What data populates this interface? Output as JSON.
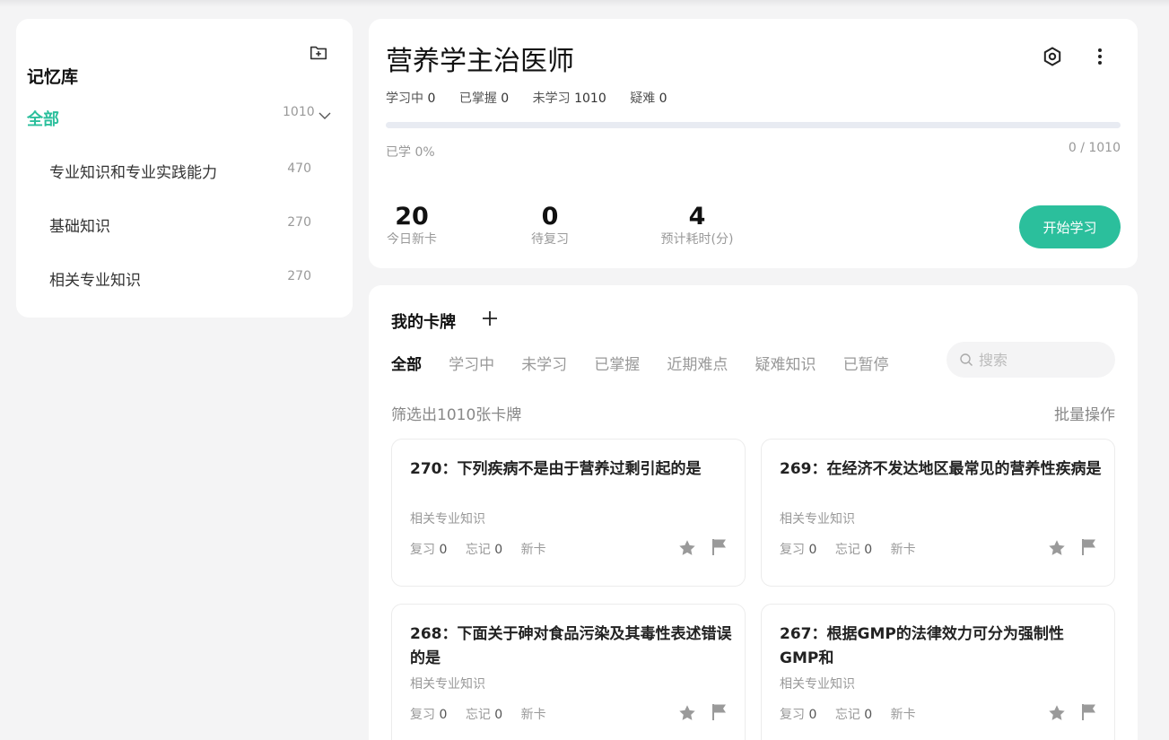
{
  "sidebar": {
    "title": "记忆库",
    "add_icon": "folder-plus-icon",
    "all": {
      "label": "全部",
      "count": "1010"
    },
    "items": [
      {
        "label": "专业知识和专业实践能力",
        "count": "470"
      },
      {
        "label": "基础知识",
        "count": "270"
      },
      {
        "label": "相关专业知识",
        "count": "270"
      }
    ]
  },
  "deck": {
    "title": "营养学主治医师",
    "stats": [
      {
        "label": "学习中",
        "value": "0"
      },
      {
        "label": "已掌握",
        "value": "0"
      },
      {
        "label": "未学习",
        "value": "1010"
      },
      {
        "label": "疑难",
        "value": "0"
      }
    ],
    "progress": {
      "percent": 0,
      "left_text": "已学 0%",
      "right_text": "0 / 1010"
    },
    "big_stats": [
      {
        "value": "20",
        "label": "今日新卡"
      },
      {
        "value": "0",
        "label": "待复习"
      },
      {
        "value": "4",
        "label": "预计耗时(分)"
      }
    ],
    "start_label": "开始学习"
  },
  "cards_panel": {
    "title": "我的卡牌",
    "tabs": [
      {
        "label": "全部",
        "active": true
      },
      {
        "label": "学习中",
        "active": false
      },
      {
        "label": "未学习",
        "active": false
      },
      {
        "label": "已掌握",
        "active": false
      },
      {
        "label": "近期难点",
        "active": false
      },
      {
        "label": "疑难知识",
        "active": false
      },
      {
        "label": "已暂停",
        "active": false
      }
    ],
    "search_placeholder": "搜索",
    "filter_text": "筛选出1010张卡牌",
    "bulk_label": "批量操作",
    "cards": [
      {
        "question": "270：下列疾病不是由于营养过剩引起的是",
        "category": "相关专业知识",
        "review_label": "复习",
        "review": "0",
        "forget_label": "忘记",
        "forget": "0",
        "status": "新卡"
      },
      {
        "question": "269：在经济不发达地区最常见的营养性疾病是",
        "category": "相关专业知识",
        "review_label": "复习",
        "review": "0",
        "forget_label": "忘记",
        "forget": "0",
        "status": "新卡"
      },
      {
        "question": "268：下面关于砷对食品污染及其毒性表述错误的是",
        "category": "相关专业知识",
        "review_label": "复习",
        "review": "0",
        "forget_label": "忘记",
        "forget": "0",
        "status": "新卡"
      },
      {
        "question": "267：根据GMP的法律效力可分为强制性GMP和",
        "category": "相关专业知识",
        "review_label": "复习",
        "review": "0",
        "forget_label": "忘记",
        "forget": "0",
        "status": "新卡"
      }
    ]
  },
  "colors": {
    "accent": "#2bbf9c",
    "muted": "#999999",
    "background": "#f4f4f5"
  }
}
